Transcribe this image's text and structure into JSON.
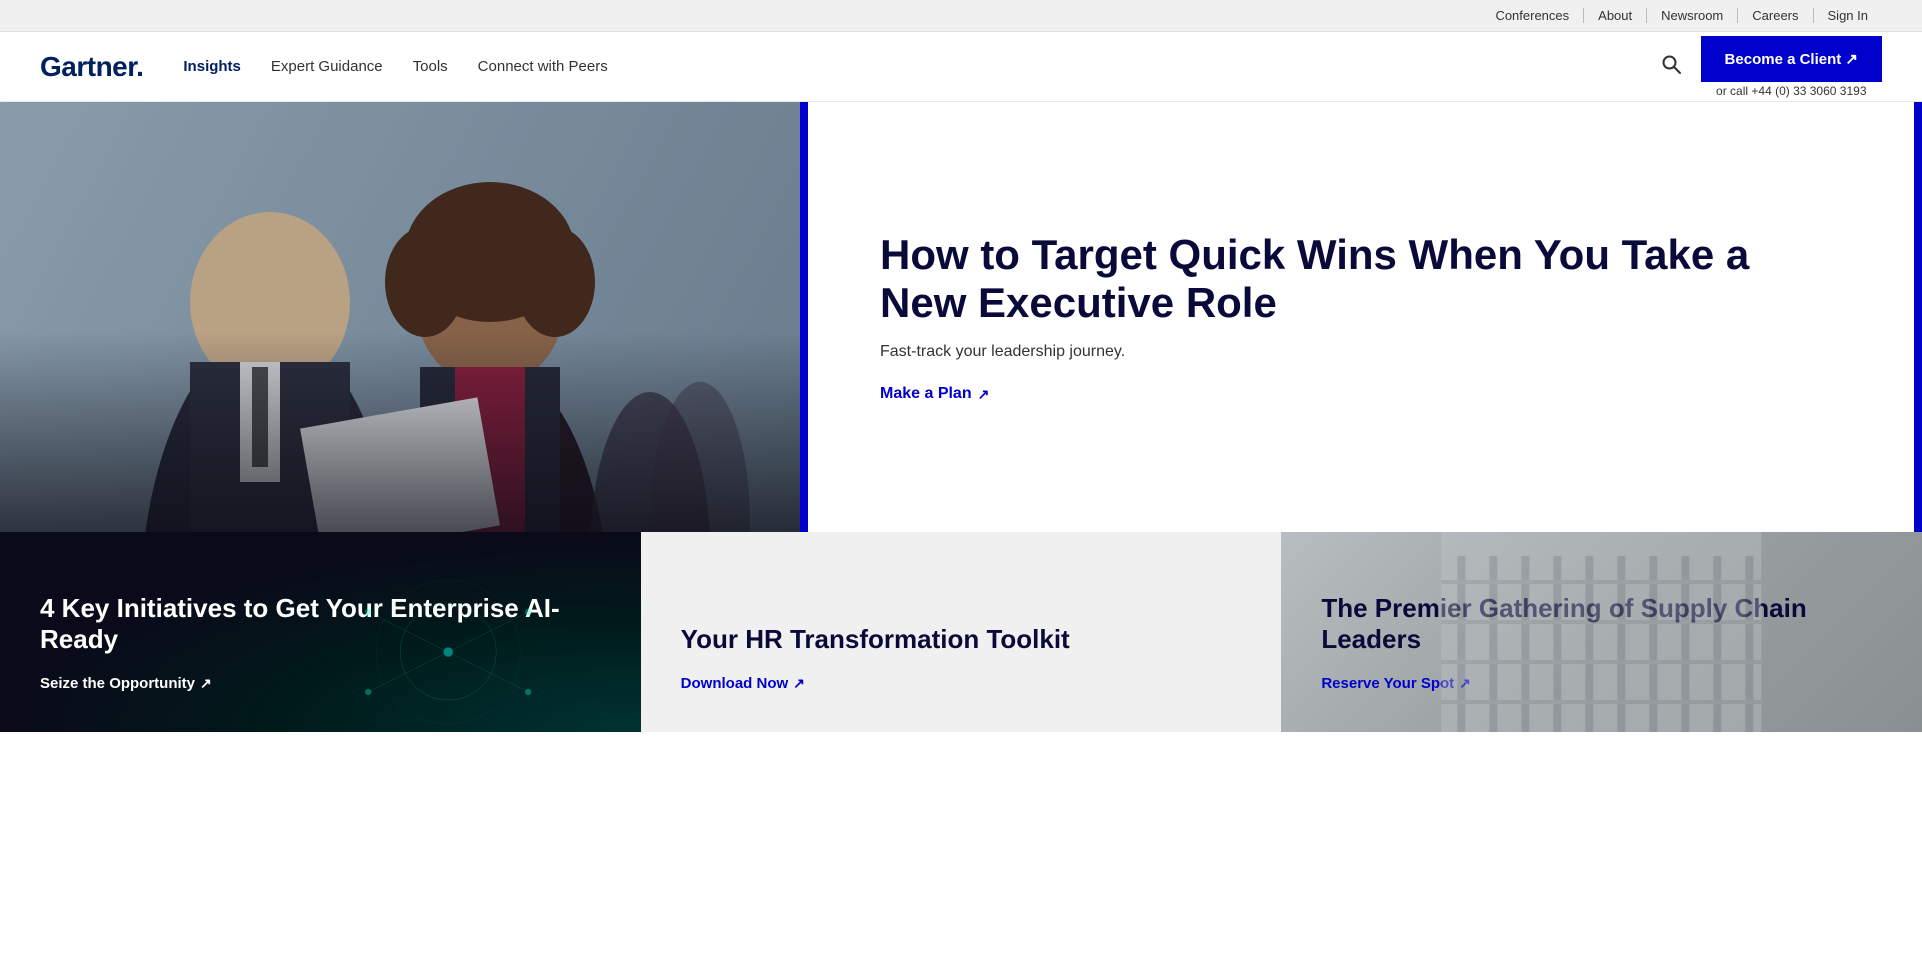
{
  "topbar": {
    "links": [
      {
        "label": "Conferences",
        "id": "conferences"
      },
      {
        "label": "About",
        "id": "about"
      },
      {
        "label": "Newsroom",
        "id": "newsroom"
      },
      {
        "label": "Careers",
        "id": "careers"
      },
      {
        "label": "Sign In",
        "id": "signin"
      }
    ]
  },
  "nav": {
    "logo": "Gartner.",
    "links": [
      {
        "label": "Insights",
        "id": "insights",
        "active": true
      },
      {
        "label": "Expert Guidance",
        "id": "expert-guidance"
      },
      {
        "label": "Tools",
        "id": "tools"
      },
      {
        "label": "Connect with Peers",
        "id": "connect-with-peers"
      }
    ],
    "become_client_label": "Become a Client ↗",
    "call_text": "or call +44 (0) 33 3060 3193"
  },
  "hero": {
    "title": "How to Target Quick Wins When You Take a New Executive Role",
    "subtitle": "Fast-track your leadership journey.",
    "cta_label": "Make a Plan",
    "cta_arrow": "↗"
  },
  "cards": [
    {
      "id": "card-ai",
      "style": "dark",
      "title": "4 Key Initiatives to Get Your Enterprise AI-Ready",
      "cta_label": "Seize the Opportunity",
      "cta_arrow": "↗"
    },
    {
      "id": "card-hr",
      "style": "light",
      "title": "Your HR Transformation Toolkit",
      "cta_label": "Download Now",
      "cta_arrow": "↗"
    },
    {
      "id": "card-supply",
      "style": "image",
      "title": "The Premier Gathering of Supply Chain Leaders",
      "cta_label": "Reserve Your Spot",
      "cta_arrow": "↗"
    }
  ]
}
